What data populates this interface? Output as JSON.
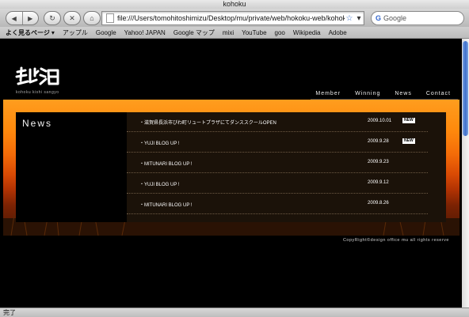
{
  "window": {
    "title": "kohoku"
  },
  "toolbar": {
    "url": "file:///Users/tomohitoshimizu/Desktop/mu/private/web/hokoku-web/kohoku.html",
    "search_placeholder": "Google"
  },
  "bookmarks": {
    "items": [
      "よく見るページ",
      "アップル",
      "Google",
      "Yahoo! JAPAN",
      "Google マップ",
      "mixi",
      "YouTube",
      "goo",
      "Wikipedia",
      "Adobe"
    ]
  },
  "site": {
    "logo_text": "北湖",
    "logo_subtitle": "kohoku kishi sangyo",
    "nav": [
      "Member",
      "Winning",
      "News",
      "Contact"
    ],
    "news_heading": "News",
    "news": [
      {
        "title": "・滋賀県長浜市びわ町リュートプラザにてダンススクールOPEN",
        "date": "2009.10.01",
        "badge": "NEW"
      },
      {
        "title": "・YUJI BLOG UP !",
        "date": "2009.9.28",
        "badge": "NEW"
      },
      {
        "title": "・MITUNARI BLOG UP !",
        "date": "2009.9.23",
        "badge": ""
      },
      {
        "title": "・YUJI BLOG UP !",
        "date": "2009.9.12",
        "badge": ""
      },
      {
        "title": "・MITUNARI BLOG UP !",
        "date": "2009.8.26",
        "badge": ""
      }
    ],
    "copyright": "CopyRight©design office mu all rights reserve"
  },
  "status": {
    "text": "完了"
  },
  "colors": {
    "accent_orange": "#ff8a0d",
    "background": "#000000"
  }
}
